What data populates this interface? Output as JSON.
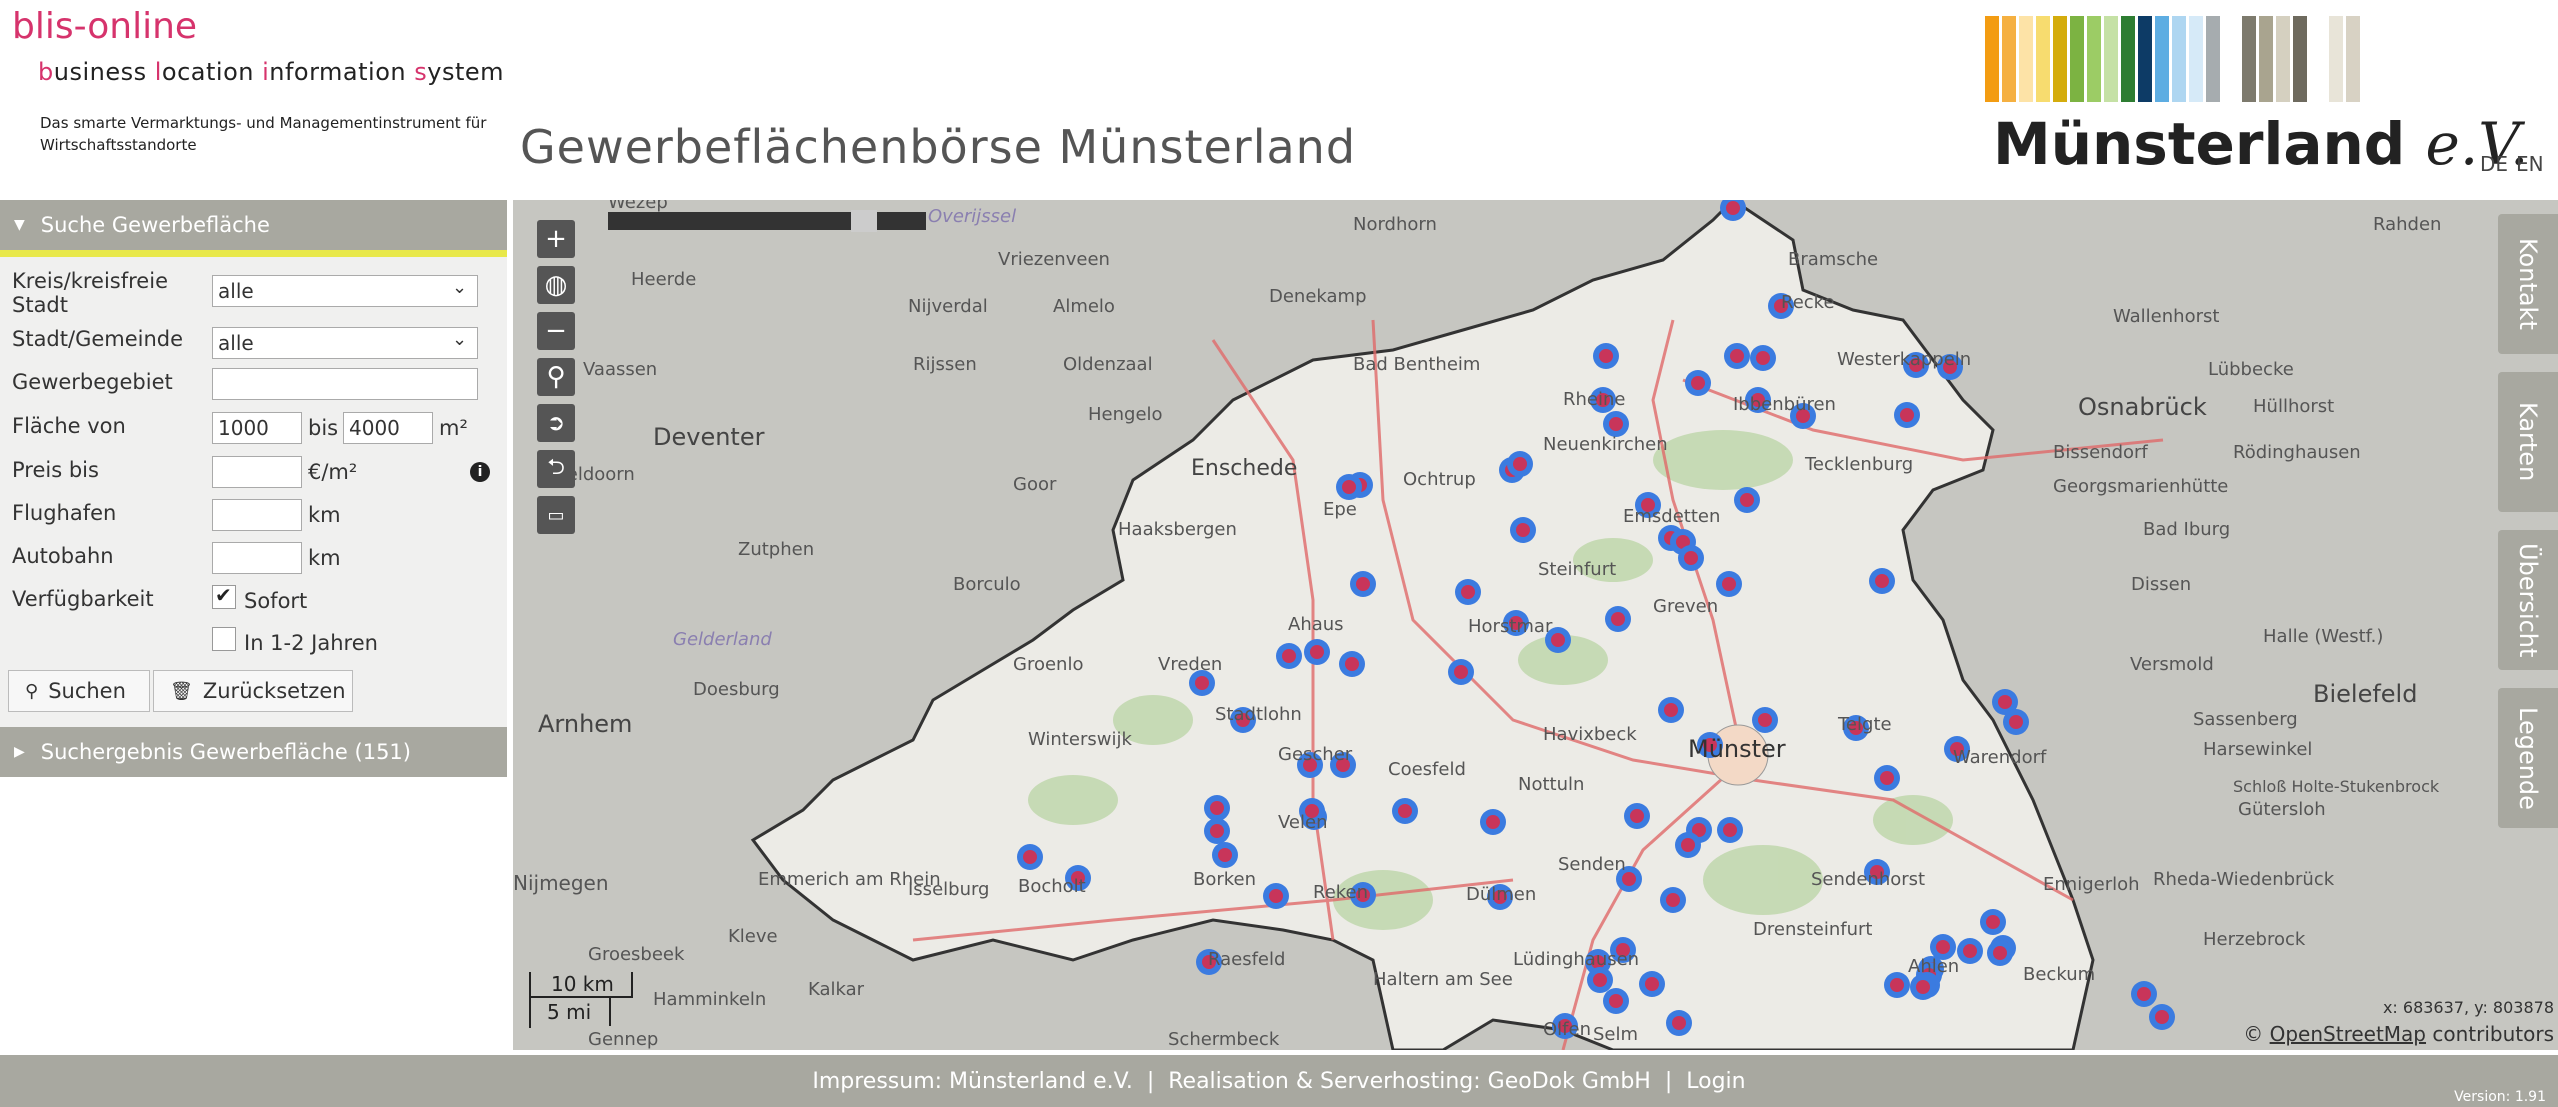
{
  "header": {
    "logo_title": "blis-online",
    "logo_subtitle_parts": [
      "b",
      "usiness ",
      "l",
      "ocation ",
      "i",
      "nformation ",
      "s",
      "ystem"
    ],
    "logo_tagline": "Das smarte Vermarktungs- und Managementinstrument für Wirtschaftsstandorte",
    "page_title": "Gewerbeflächenbörse Münsterland",
    "brand_name": "Münsterland",
    "brand_suffix": "e.V.",
    "languages": [
      "DE",
      "EN"
    ],
    "brand_colors": [
      "#f39c12",
      "#f5b041",
      "#fde3a7",
      "#f7dc6f",
      "#d4ac0d",
      "#7cb342",
      "#9ccc65",
      "#c5e1a5",
      "#2e7d32",
      "#0d3b66",
      "#5dade2",
      "#aed6f1",
      "#d6eaf8",
      "#a6acaf",
      "#7d7a6d",
      "#a9a48f",
      "#d5d0c0",
      "#6e6a5e",
      "#e8e4d8",
      "#d8d2c4"
    ]
  },
  "search_panel": {
    "title": "Suche Gewerbefläche",
    "fields": {
      "kreis_label": "Kreis/kreisfreie Stadt",
      "kreis_value": "alle",
      "stadt_label": "Stadt/Gemeinde",
      "stadt_value": "alle",
      "gebiet_label": "Gewerbegebiet",
      "gebiet_value": "",
      "flaeche_label": "Fläche von",
      "flaeche_from": "1000",
      "flaeche_bis": "bis",
      "flaeche_to": "4000",
      "flaeche_unit": "m²",
      "preis_label": "Preis bis",
      "preis_value": "",
      "preis_unit": "€/m²",
      "flughafen_label": "Flughafen",
      "flughafen_value": "",
      "flughafen_unit": "km",
      "autobahn_label": "Autobahn",
      "autobahn_value": "",
      "autobahn_unit": "km",
      "verfuegbarkeit_label": "Verfügbarkeit",
      "option_sofort": "Sofort",
      "option_1_2": "In 1-2 Jahren"
    },
    "search_button": "Suchen",
    "reset_button": "Zurücksetzen"
  },
  "results_panel": {
    "title": "Suchergebnis Gewerbefläche (151)"
  },
  "map": {
    "side_tabs": [
      "Kontakt",
      "Karten",
      "Übersicht",
      "Legende"
    ],
    "scale_km": "10 km",
    "scale_mi": "5 mi",
    "coords": "x: 683637, y: 803878",
    "attribution_prefix": "©",
    "attribution_link": "OpenStreetMap",
    "attribution_suffix": "contributors",
    "places": [
      "Wezep",
      "Overijssel",
      "Nordhorn",
      "Bramsche",
      "Rahden",
      "Vriezenveen",
      "Heerde",
      "Nijverdal",
      "Almelo",
      "Denekamp",
      "Recke",
      "Wallenhorst",
      "Westerkappeln",
      "Lübbecke",
      "Vaassen",
      "Rijssen",
      "Oldenzaal",
      "Bad Bentheim",
      "Rheine",
      "Ibbenbüren",
      "Osnabrück",
      "Hüllhorst",
      "Deventer",
      "Hengelo",
      "Neuenkirchen",
      "Tecklenburg",
      "Bissendorf",
      "Rödinghausen",
      "Apeldoorn",
      "Enschede",
      "Ochtrup",
      "Georgsmarienhütte",
      "Bad Iburg",
      "Goor",
      "Haaksbergen",
      "Epe",
      "Emsdetten",
      "Zutphen",
      "Borculo",
      "Steinfurt",
      "Dissen",
      "Ahaus",
      "Horstmar",
      "Greven",
      "Halle (Westf.)",
      "Gelderland",
      "Groenlo",
      "Vreden",
      "Versmold",
      "Bielefeld",
      "Doesburg",
      "Stadtlohn",
      "Telgte",
      "Sassenberg",
      "Arnhem",
      "Winterswijk",
      "Havixbeck",
      "Münster",
      "Warendorf",
      "Harsewinkel",
      "Gescher",
      "Coesfeld",
      "Nottuln",
      "Gütersloh",
      "Velen",
      "Schloß Holte-Stukenbrock",
      "Emmerich am Rhein",
      "Bocholt",
      "Borken",
      "Senden",
      "Sendenhorst",
      "Ennigerloh",
      "Isselburg",
      "Reken",
      "Dülmen",
      "Drensteinfurt",
      "Rheda-Wiedenbrück",
      "Kleve",
      "Herzebrock",
      "Groesbeek",
      "Raesfeld",
      "Lüdinghausen",
      "Ahlen",
      "Beckum",
      "Kalkar",
      "Hamminkeln",
      "Haltern am See",
      "Olfen",
      "Selm",
      "Gennep",
      "Schermbeck",
      "Nijmegen"
    ]
  },
  "footer": {
    "impressum": "Impressum: Münsterland e.V.",
    "realisation": "Realisation & Serverhosting: GeoDok GmbH",
    "login": "Login",
    "version": "Version: 1.91"
  }
}
